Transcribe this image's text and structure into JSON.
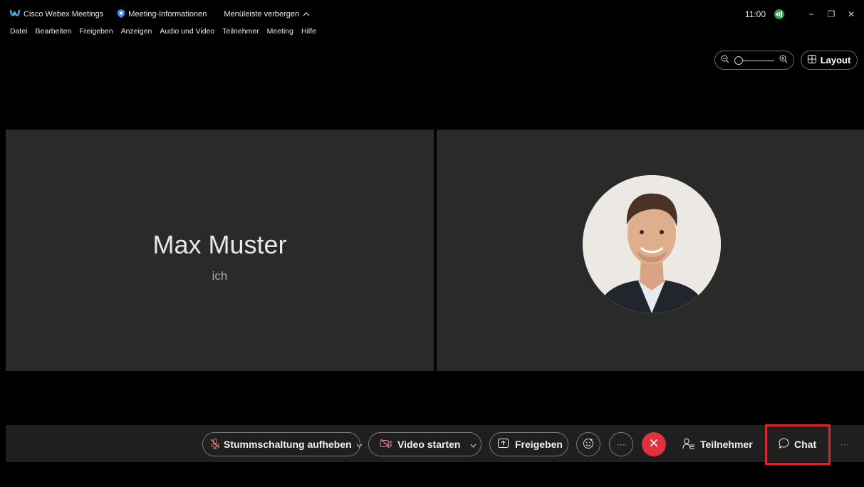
{
  "titlebar": {
    "app_title": "Cisco Webex Meetings",
    "meeting_info": "Meeting-Informationen",
    "hide_menu": "Menüleiste verbergen",
    "clock": "11:00",
    "minimize": "−",
    "restore": "❐",
    "close": "✕"
  },
  "menu": [
    "Datei",
    "Bearbeiten",
    "Freigeben",
    "Anzeigen",
    "Audio und Video",
    "Teilnehmer",
    "Meeting",
    "Hilfe"
  ],
  "view_controls": {
    "layout_label": "Layout"
  },
  "tiles": {
    "self_name": "Max Muster",
    "self_sub": "ich"
  },
  "controls": {
    "unmute_label": "Stummschaltung aufheben",
    "video_label": "Video starten",
    "share_label": "Freigeben",
    "participants_label": "Teilnehmer",
    "chat_label": "Chat",
    "more_glyph": "···"
  },
  "colors": {
    "end_call": "#e0313f",
    "highlight": "#d9252b",
    "tile_bg": "#2a2a2a",
    "muted_icon": "#e87a8a"
  }
}
